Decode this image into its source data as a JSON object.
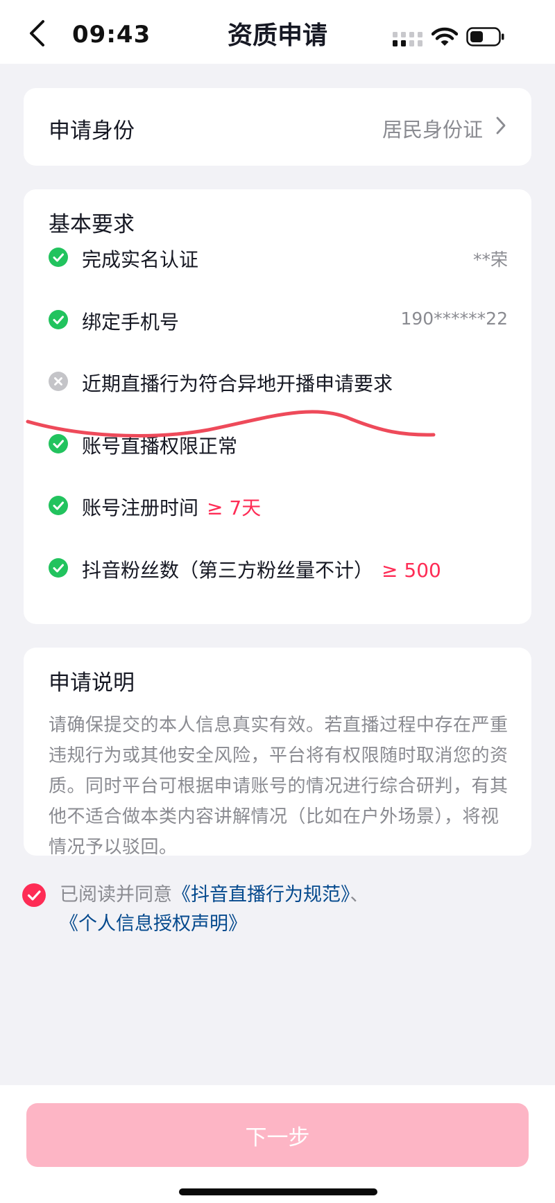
{
  "status_bar": {
    "time": "09:43"
  },
  "header": {
    "title": "资质申请"
  },
  "identity": {
    "label": "申请身份",
    "value": "居民身份证"
  },
  "requirements": {
    "title": "基本要求",
    "items": [
      {
        "text": "完成实名认证",
        "status": "passed",
        "value": "**荣"
      },
      {
        "text": "绑定手机号",
        "status": "passed",
        "value": "190******22"
      },
      {
        "text": "近期直播行为符合异地开播申请要求",
        "status": "failed"
      },
      {
        "text": "账号直播权限正常",
        "status": "passed"
      },
      {
        "text": "账号注册时间",
        "status": "passed",
        "condition": "≥ 7天"
      },
      {
        "text": "抖音粉丝数（第三方粉丝量不计）",
        "status": "passed",
        "condition": "≥ 500"
      }
    ]
  },
  "notes": {
    "title": "申请说明",
    "body": "请确保提交的本人信息真实有效。若直播过程中存在严重违规行为或其他安全风险，平台将有权限随时取消您的资质。同时平台可根据申请账号的情况进行综合研判，有其他不适合做本类内容讲解情况（比如在户外场景），将视情况予以驳回。"
  },
  "agreement": {
    "checked": true,
    "prefix": "已阅读并同意",
    "link1": "《抖音直播行为规范》",
    "separator": "、",
    "link2": "《个人信息授权声明》"
  },
  "footer": {
    "next_label": "下一步"
  },
  "colors": {
    "accent": "#fe2c55",
    "pass_green": "#22c35e",
    "fail_gray": "#c4c4c8",
    "link_blue": "#04498d",
    "button_disabled": "#fdb5c5",
    "annotation_red": "#ee4a5a"
  }
}
